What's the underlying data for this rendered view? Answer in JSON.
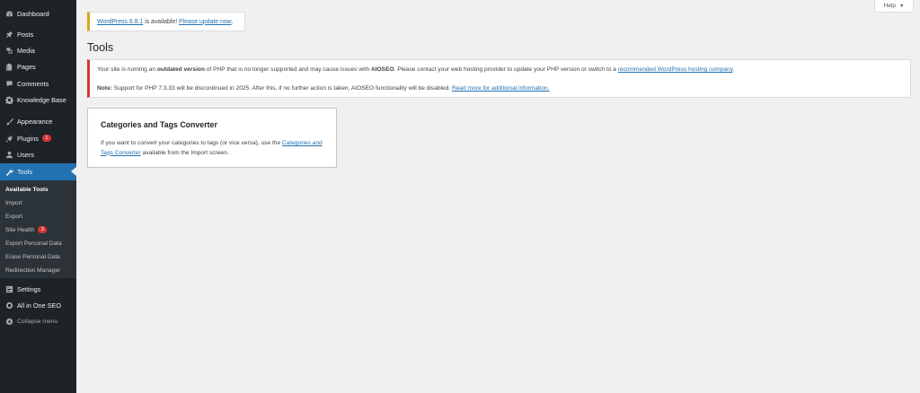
{
  "sidebar": {
    "items": [
      {
        "key": "dashboard",
        "label": "Dashboard",
        "icon": "dashboard-icon"
      },
      {
        "key": "posts",
        "label": "Posts",
        "icon": "pin-icon"
      },
      {
        "key": "media",
        "label": "Media",
        "icon": "media-icon"
      },
      {
        "key": "pages",
        "label": "Pages",
        "icon": "pages-icon"
      },
      {
        "key": "comments",
        "label": "Comments",
        "icon": "comment-icon"
      },
      {
        "key": "knowledge-base",
        "label": "Knowledge Base",
        "icon": "gear-icon"
      },
      {
        "key": "appearance",
        "label": "Appearance",
        "icon": "brush-icon"
      },
      {
        "key": "plugins",
        "label": "Plugins",
        "icon": "plug-icon",
        "badge": "1"
      },
      {
        "key": "users",
        "label": "Users",
        "icon": "users-icon"
      },
      {
        "key": "tools",
        "label": "Tools",
        "icon": "wrench-icon",
        "active": true
      },
      {
        "key": "settings",
        "label": "Settings",
        "icon": "settings-icon"
      },
      {
        "key": "aioseo",
        "label": "All in One SEO",
        "icon": "aioseo-icon"
      },
      {
        "key": "collapse",
        "label": "Collapse menu",
        "icon": "collapse-icon"
      }
    ],
    "submenu": [
      {
        "label": "Available Tools",
        "current": true
      },
      {
        "label": "Import"
      },
      {
        "label": "Export"
      },
      {
        "label": "Site Health",
        "badge": "3"
      },
      {
        "label": "Export Personal Data"
      },
      {
        "label": "Erase Personal Data"
      },
      {
        "label": "Redirection Manager"
      }
    ]
  },
  "help": {
    "label": "Help",
    "arrow": "▼"
  },
  "update_nag": {
    "version_link": "WordPress 6.8.1",
    "middle": " is available! ",
    "update_link": "Please update now",
    "end": "."
  },
  "page_title": "Tools",
  "php_notice": {
    "line1_a": "Your site is running an ",
    "line1_b": "outdated version",
    "line1_c": " of PHP that is no longer supported and may cause issues with ",
    "line1_d": "AIOSEO",
    "line1_e": ". Please contact your web hosting provider to update your PHP version or switch to a ",
    "line1_link": "recommended WordPress hosting company",
    "line1_f": ".",
    "line2_a": "Note:",
    "line2_b": " Support for PHP 7.3.33 will be discontinued in 2025. After this, if no further action is taken, AIOSEO functionality will be disabled. ",
    "line2_link": "Read more for additional information."
  },
  "card": {
    "title": "Categories and Tags Converter",
    "desc_a": "If you want to convert your categories to tags (or vice versa), use the ",
    "desc_link": "Categories and Tags Converter",
    "desc_b": " available from the Import screen."
  },
  "colors": {
    "sidebar_bg": "#1d2327",
    "active": "#2271b1",
    "error": "#d63638",
    "warning": "#dba617"
  }
}
